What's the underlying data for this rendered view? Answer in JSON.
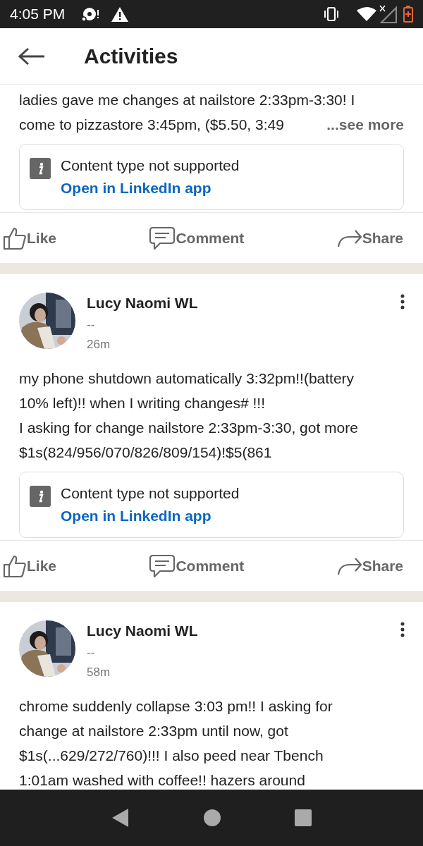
{
  "status_bar": {
    "time": "4:05 PM"
  },
  "header": {
    "title": "Activities"
  },
  "posts": [
    {
      "kind": "continued",
      "lines": [
        "ladies gave me changes at nailstore 2:33pm-3:30! I",
        "come to pizzastore 3:45pm, ($5.50, 3:49"
      ],
      "see_more": "...see more",
      "notice": {
        "message": "Content type not supported",
        "link": "Open in LinkedIn app"
      },
      "actions": [
        "Like",
        "Comment",
        "Share"
      ]
    },
    {
      "kind": "full",
      "author": "Lucy Naomi WL",
      "headline": "--",
      "time": "26m",
      "lines": [
        "my phone shutdown automatically 3:32pm!!(battery",
        "10% left)!! when I writing changes# !!!",
        "I asking for change nailstore 2:33pm-3:30, got more",
        "$1s(824/956/070/826/809/154)!$5(861"
      ],
      "notice": {
        "message": "Content type not supported",
        "link": "Open in LinkedIn app"
      },
      "actions": [
        "Like",
        "Comment",
        "Share"
      ]
    },
    {
      "kind": "full",
      "author": "Lucy Naomi WL",
      "headline": "--",
      "time": "58m",
      "lines": [
        "chrome suddenly collapse 3:03 pm!! I asking for",
        "change at nailstore 2:33pm until now, got",
        "$1s(...629/272/760)!!! I also peed near Tbench",
        "1:01am washed with coffee!! hazers around"
      ]
    }
  ]
}
